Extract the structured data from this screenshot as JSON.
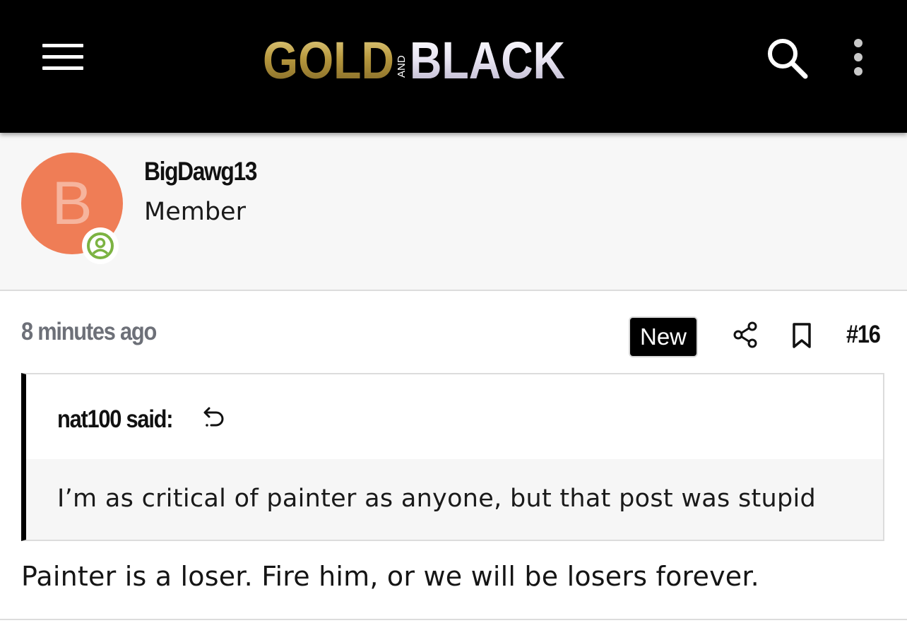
{
  "header": {
    "logo": {
      "word_gold": "GOLD",
      "word_and": "AND",
      "word_black": "BLACK",
      "gold_color": "#b89a3e",
      "black_word_color": "#ffffff"
    },
    "menu_icon": "hamburger-menu-icon",
    "search_icon": "search-icon",
    "more_icon": "more-vertical-icon"
  },
  "author": {
    "avatar_letter": "B",
    "avatar_color": "#ef7d56",
    "username": "BigDawg13",
    "title": "Member",
    "status_icon": "online-status-icon",
    "status_color": "#7cb342"
  },
  "post": {
    "timestamp": "8 minutes ago",
    "new_label": "New",
    "number": "#16",
    "share_icon": "share-icon",
    "bookmark_icon": "bookmark-icon",
    "quote": {
      "author_line": "nat100 said:",
      "jump_icon": "jump-to-quote-icon",
      "text": "I’m as critical of painter as anyone, but that post was stupid"
    },
    "message": "Painter is a loser. Fire him, or we will be losers forever."
  }
}
